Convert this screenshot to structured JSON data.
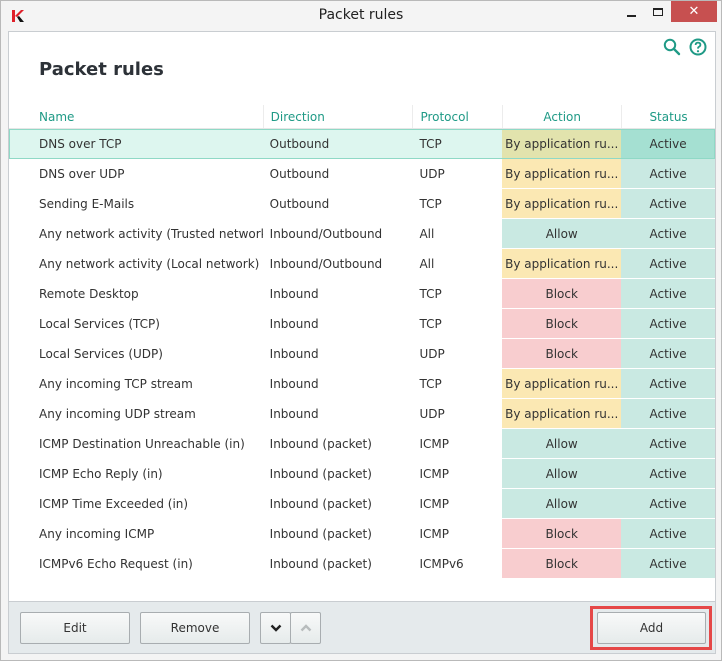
{
  "window": {
    "title": "Packet rules",
    "close_glyph": "✕",
    "icons": [
      "kaspersky-logo-icon",
      "minimize-icon",
      "maximize-icon",
      "close-icon"
    ]
  },
  "header": {
    "page_title": "Packet rules",
    "icons": [
      "search-icon",
      "help-icon"
    ],
    "accent_color": "#1f9a86"
  },
  "table": {
    "columns": [
      "Name",
      "Direction",
      "Protocol",
      "Action",
      "Status"
    ],
    "rows": [
      {
        "name": "DNS over TCP",
        "direction": "Outbound",
        "protocol": "TCP",
        "action": "By application ru...",
        "action_type": "app",
        "status": "Active",
        "selected": true
      },
      {
        "name": "DNS over UDP",
        "direction": "Outbound",
        "protocol": "UDP",
        "action": "By application ru...",
        "action_type": "app",
        "status": "Active"
      },
      {
        "name": "Sending E-Mails",
        "direction": "Outbound",
        "protocol": "TCP",
        "action": "By application ru...",
        "action_type": "app",
        "status": "Active"
      },
      {
        "name": "Any network activity (Trusted network)",
        "direction": "Inbound/Outbound",
        "protocol": "All",
        "action": "Allow",
        "action_type": "allow",
        "status": "Active"
      },
      {
        "name": "Any network activity (Local network)",
        "direction": "Inbound/Outbound",
        "protocol": "All",
        "action": "By application ru...",
        "action_type": "app",
        "status": "Active"
      },
      {
        "name": "Remote Desktop",
        "direction": "Inbound",
        "protocol": "TCP",
        "action": "Block",
        "action_type": "block",
        "status": "Active"
      },
      {
        "name": "Local Services (TCP)",
        "direction": "Inbound",
        "protocol": "TCP",
        "action": "Block",
        "action_type": "block",
        "status": "Active"
      },
      {
        "name": "Local Services (UDP)",
        "direction": "Inbound",
        "protocol": "UDP",
        "action": "Block",
        "action_type": "block",
        "status": "Active"
      },
      {
        "name": "Any incoming TCP stream",
        "direction": "Inbound",
        "protocol": "TCP",
        "action": "By application ru...",
        "action_type": "app",
        "status": "Active"
      },
      {
        "name": "Any incoming UDP stream",
        "direction": "Inbound",
        "protocol": "UDP",
        "action": "By application ru...",
        "action_type": "app",
        "status": "Active"
      },
      {
        "name": "ICMP Destination Unreachable (in)",
        "direction": "Inbound (packet)",
        "protocol": "ICMP",
        "action": "Allow",
        "action_type": "allow",
        "status": "Active"
      },
      {
        "name": "ICMP Echo Reply (in)",
        "direction": "Inbound (packet)",
        "protocol": "ICMP",
        "action": "Allow",
        "action_type": "allow",
        "status": "Active"
      },
      {
        "name": "ICMP Time Exceeded (in)",
        "direction": "Inbound (packet)",
        "protocol": "ICMP",
        "action": "Allow",
        "action_type": "allow",
        "status": "Active"
      },
      {
        "name": "Any incoming ICMP",
        "direction": "Inbound (packet)",
        "protocol": "ICMP",
        "action": "Block",
        "action_type": "block",
        "status": "Active"
      },
      {
        "name": "ICMPv6 Echo Request (in)",
        "direction": "Inbound (packet)",
        "protocol": "ICMPv6",
        "action": "Block",
        "action_type": "block",
        "status": "Active"
      }
    ],
    "action_colors": {
      "app": "#fbe8b3",
      "allow": "#c9e9e2",
      "block": "#f8cdcf"
    },
    "status_color": "#c9e9e2"
  },
  "footer": {
    "edit_label": "Edit",
    "remove_label": "Remove",
    "move_down_glyph": "⌄",
    "move_up_glyph": "⌃",
    "add_label": "Add",
    "highlight_color": "#e54848"
  }
}
